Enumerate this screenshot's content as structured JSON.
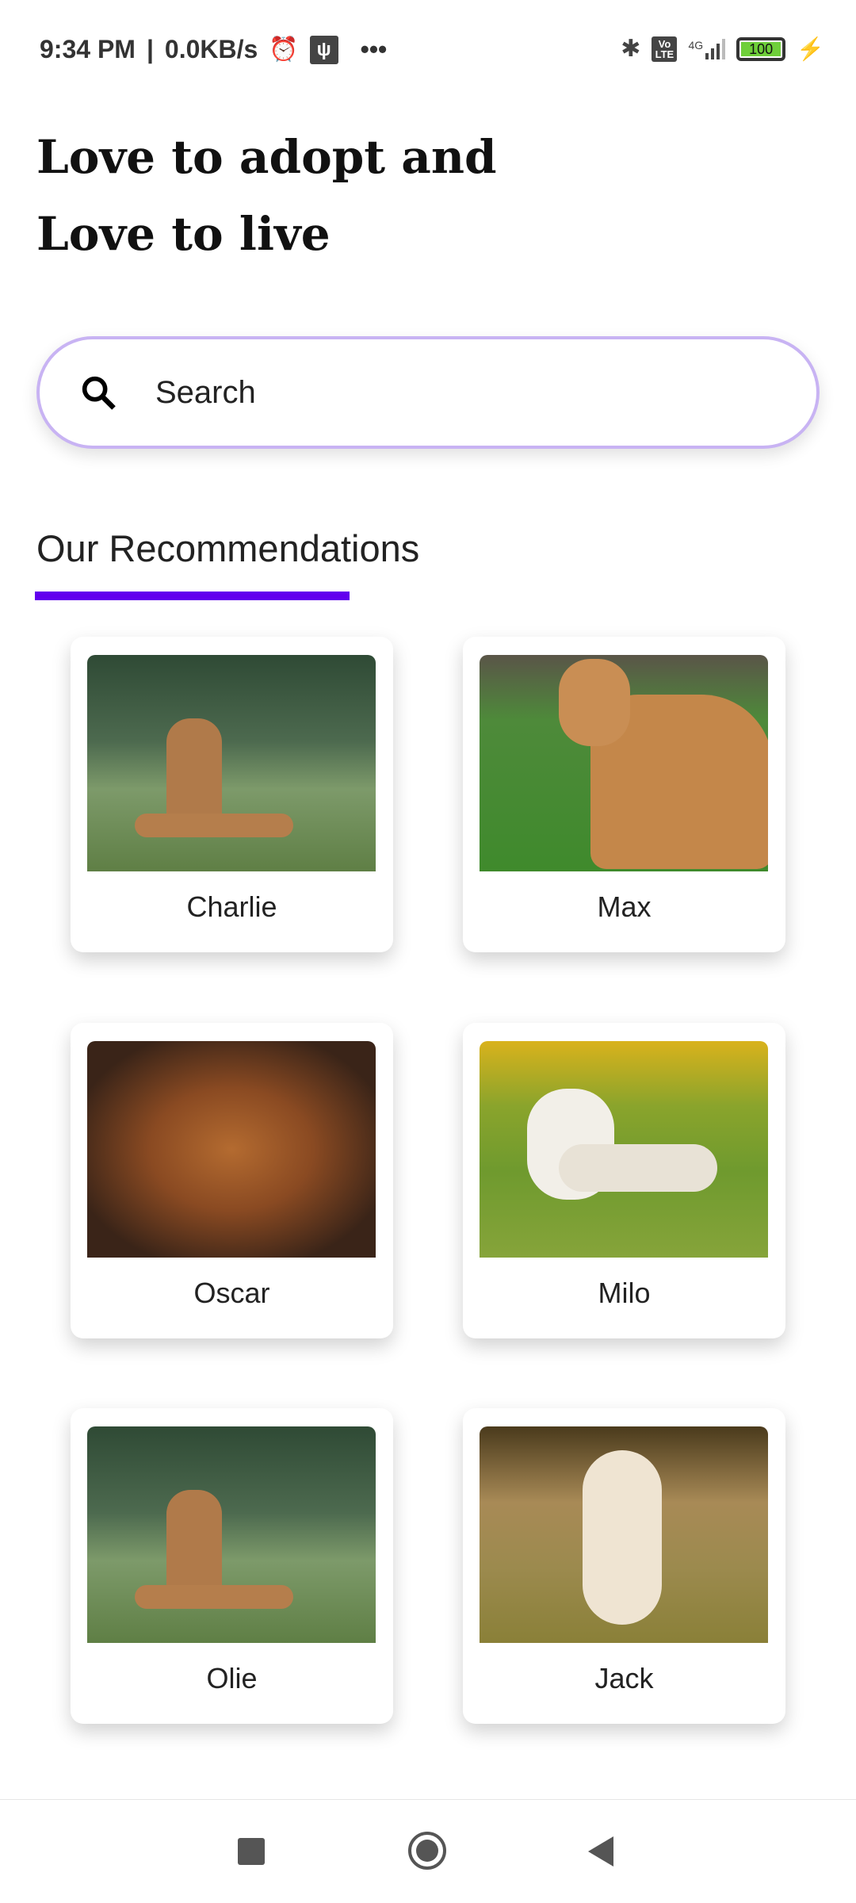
{
  "status_bar": {
    "time": "9:34 PM",
    "speed": "0.0KB/s",
    "network": "4G",
    "volte": "Vo LTE",
    "battery": "100"
  },
  "header": {
    "title_line1": "Love to adopt and",
    "title_line2": "Love to live"
  },
  "search": {
    "placeholder": "Search"
  },
  "section": {
    "title": "Our Recommendations",
    "accent_color": "#6200ee"
  },
  "pets": [
    {
      "name": "Charlie"
    },
    {
      "name": "Max"
    },
    {
      "name": "Oscar"
    },
    {
      "name": "Milo"
    },
    {
      "name": "Olie"
    },
    {
      "name": "Jack"
    }
  ]
}
